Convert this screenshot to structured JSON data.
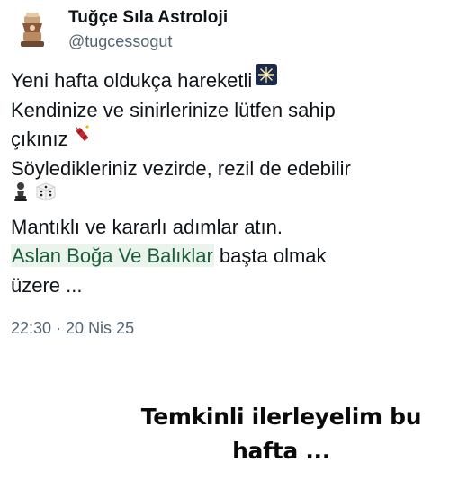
{
  "tweet": {
    "author_name": "Tuğçe Sıla Astroloji",
    "author_handle": "@tugcessogut",
    "lines": [
      "Yeni hafta oldukça hareketli",
      "Kendinize ve sinirlerinize lütfen sahip",
      "çıkınız",
      "Söyledikleriniz vezirde, rezil de edebilir",
      "",
      "Mantıklı ve kararlı adımlar atın."
    ],
    "highlight_text": "Aslan Boğa Ve Balıklar",
    "highlight_tail": " başta olmak",
    "last_line": "üzere  ...",
    "timestamp": "22:30 · 20 Nis 25",
    "emojis": {
      "line1": "sparkler-icon",
      "line3": "firecracker-icon",
      "line5a": "chess-pawn-icon",
      "line5b": "dice-icon"
    },
    "colors": {
      "highlight_bg": "#eaf4ec",
      "highlight_fg": "#1d5c3a",
      "muted": "#536471"
    }
  },
  "caption": {
    "text": "Temkinli ilerleyelim bu hafta ..."
  }
}
